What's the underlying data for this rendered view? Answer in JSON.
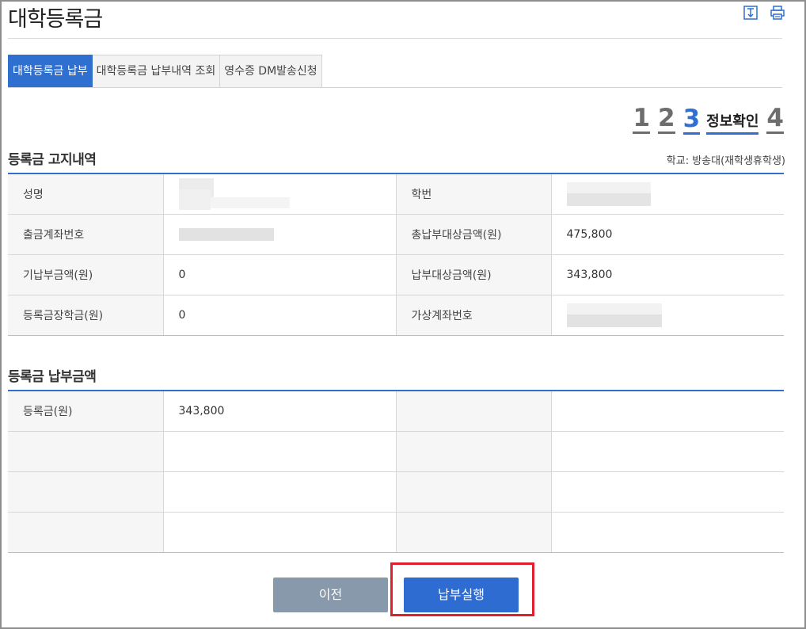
{
  "page": {
    "title": "대학등록금"
  },
  "tabs": [
    {
      "label": "대학등록금 납부",
      "active": true
    },
    {
      "label": "대학등록금 납부내역 조회",
      "active": false
    },
    {
      "label": "영수증 DM발송신청",
      "active": false
    }
  ],
  "steps": {
    "s1": "1",
    "s2": "2",
    "s3": "3",
    "s3_name": "정보확인",
    "s4": "4",
    "current": 3
  },
  "notice": {
    "title": "등록금 고지내역",
    "school": "학교: 방송대(재학생휴학생)",
    "rows": [
      {
        "l1": "성명",
        "v1": "",
        "l2": "학번",
        "v2": ""
      },
      {
        "l1": "출금계좌번호",
        "v1": "",
        "l2": "총납부대상금액(원)",
        "v2": "475,800"
      },
      {
        "l1": "기납부금액(원)",
        "v1": "0",
        "l2": "납부대상금액(원)",
        "v2": "343,800"
      },
      {
        "l1": "등록금장학금(원)",
        "v1": "0",
        "l2": "가상계좌번호",
        "v2": ""
      }
    ]
  },
  "payment": {
    "title": "등록금 납부금액",
    "rows": [
      {
        "l1": "등록금(원)",
        "v1": "343,800",
        "l2": "",
        "v2": ""
      },
      {
        "l1": "",
        "v1": "",
        "l2": "",
        "v2": ""
      },
      {
        "l1": "",
        "v1": "",
        "l2": "",
        "v2": ""
      },
      {
        "l1": "",
        "v1": "",
        "l2": "",
        "v2": ""
      }
    ]
  },
  "buttons": {
    "prev": "이전",
    "pay": "납부실행"
  },
  "icons": {
    "download": "download-icon",
    "print": "print-icon"
  },
  "colors": {
    "accent": "#2f6fd0",
    "prev_button": "#8899ab",
    "highlight": "#e0202c"
  }
}
